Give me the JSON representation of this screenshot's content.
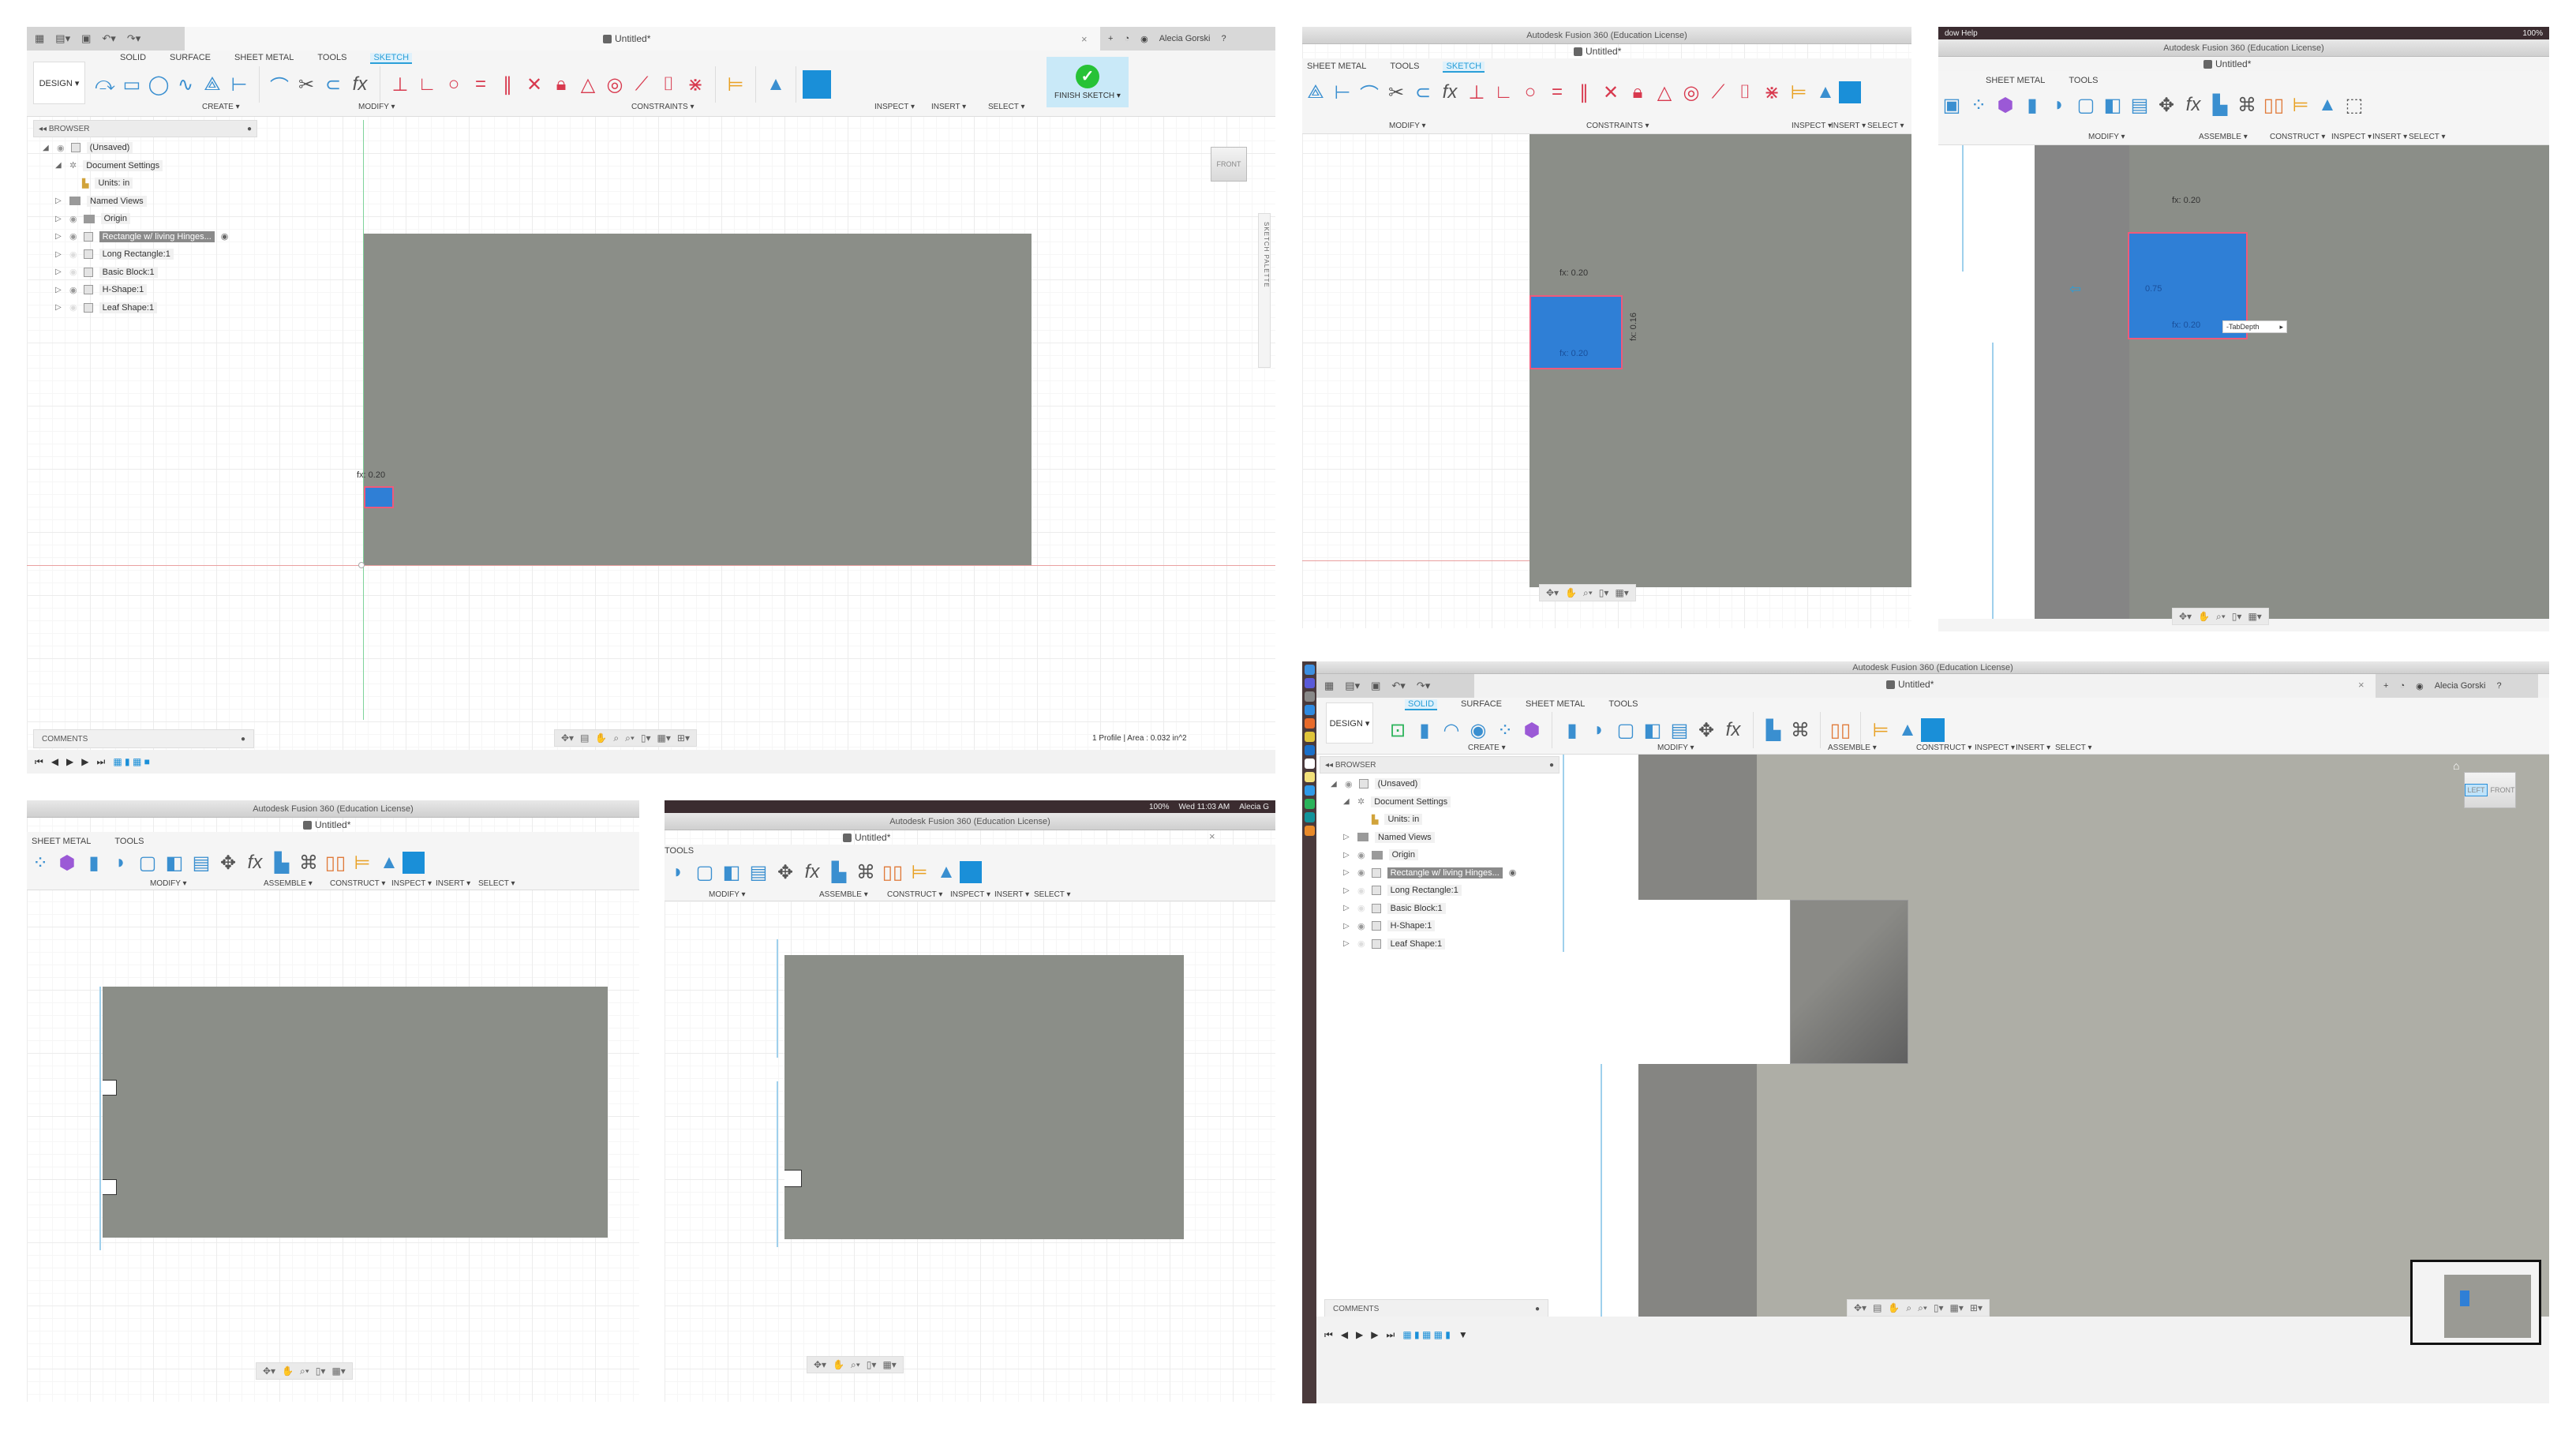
{
  "app": {
    "window_title": "Autodesk Fusion 360 (Education License)",
    "document_title": "Untitled*",
    "user_name": "Alecia Gorski"
  },
  "workspace": {
    "design_label": "DESIGN ▾"
  },
  "tabs": {
    "solid": "SOLID",
    "surface": "SURFACE",
    "sheet_metal": "SHEET METAL",
    "tools": "TOOLS",
    "sketch": "SKETCH"
  },
  "groups": {
    "create": "CREATE ▾",
    "modify": "MODIFY ▾",
    "constraints": "CONSTRAINTS ▾",
    "assemble": "ASSEMBLE ▾",
    "construct": "CONSTRUCT ▾",
    "inspect": "INSPECT ▾",
    "insert": "INSERT ▾",
    "select": "SELECT ▾",
    "finish_sketch": "FINISH SKETCH ▾"
  },
  "browser": {
    "header": "BROWSER",
    "items": [
      {
        "label": "(Unsaved)",
        "level": 0,
        "expanded": true,
        "visible": true,
        "icon": "document-icon"
      },
      {
        "label": "Document Settings",
        "level": 1,
        "expanded": true,
        "icon": "gear-icon"
      },
      {
        "label": "Units: in",
        "level": 2,
        "icon": "units-icon"
      },
      {
        "label": "Named Views",
        "level": 1,
        "expanded": false,
        "icon": "folder-icon"
      },
      {
        "label": "Origin",
        "level": 1,
        "expanded": false,
        "visible": true,
        "icon": "folder-icon"
      },
      {
        "label": "Rectangle w/ living Hinges...",
        "level": 1,
        "expanded": false,
        "visible": true,
        "selected": true,
        "icon": "component-icon"
      },
      {
        "label": "Long Rectangle:1",
        "level": 1,
        "expanded": false,
        "visible": false,
        "icon": "component-icon"
      },
      {
        "label": "Basic Block:1",
        "level": 1,
        "expanded": false,
        "visible": false,
        "icon": "component-icon"
      },
      {
        "label": "H-Shape:1",
        "level": 1,
        "expanded": false,
        "visible": true,
        "icon": "component-icon"
      },
      {
        "label": "Leaf Shape:1",
        "level": 1,
        "expanded": false,
        "visible": false,
        "icon": "component-icon"
      }
    ]
  },
  "comments": {
    "label": "COMMENTS"
  },
  "status": {
    "profile_area": "1 Profile | Area : 0.032 in^2"
  },
  "viewcube": {
    "front": "FRONT",
    "left": "LEFT"
  },
  "sketch_palette": {
    "label": "SKETCH PALETTE"
  },
  "dimensions": {
    "width_a": "fx: 0.20",
    "width_b": "fx: 0.20",
    "height": "fx: 0.16",
    "offset": "0.75",
    "input_param": "-TabDepth"
  },
  "mac": {
    "menu_left": "dow   Help",
    "battery": "100%",
    "clock": "Wed 11:03 AM",
    "user_short": "Alecia G"
  },
  "colors": {
    "accent": "#2a9fd8",
    "select_blue": "#1a8fd8",
    "finish_green": "#27c236",
    "body_gray": "#8b8e88",
    "sketch_profile": "#2f7fd6",
    "constraint_red": "#d8394e"
  }
}
